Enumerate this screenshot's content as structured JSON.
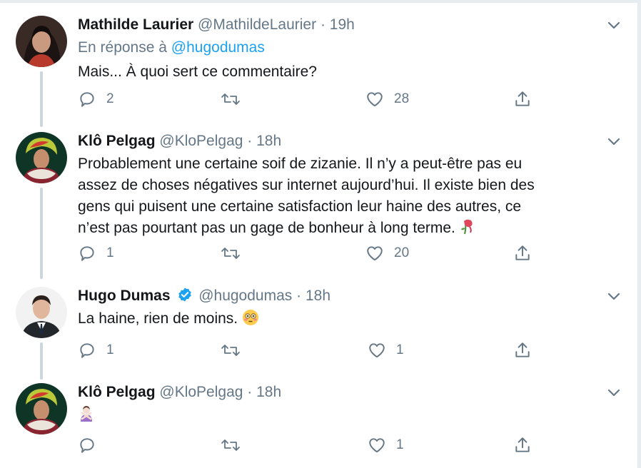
{
  "tweets": [
    {
      "name": "Mathilde Laurier",
      "handle": "@MathildeLaurier",
      "time": "19h",
      "reply_prefix": "En réponse à",
      "reply_handle": "@hugodumas",
      "text": "Mais... À quoi sert ce commentaire?",
      "replies": "2",
      "retweets": "",
      "likes": "28"
    },
    {
      "name": "Klô Pelgag",
      "handle": "@KloPelgag",
      "time": "18h",
      "text_lines": [
        "Probablement une certaine soif de zizanie. Il n’y a peut-être pas eu",
        "assez de choses négatives sur internet aujourd’hui. Il existe bien des",
        "gens qui puisent une certaine satisfaction leur haine des autres, ce",
        "n’est pas pourtant pas un gage de bonheur à long terme."
      ],
      "emoji": "wilted-rose",
      "replies": "1",
      "retweets": "",
      "likes": "20"
    },
    {
      "name": "Hugo Dumas",
      "verified": true,
      "handle": "@hugodumas",
      "time": "18h",
      "text": "La haine, rien de moins.",
      "emoji": "flushed-face",
      "replies": "1",
      "retweets": "",
      "likes": "1"
    },
    {
      "name": "Klô Pelgag",
      "handle": "@KloPelgag",
      "time": "18h",
      "emoji": "person-gesturing-no",
      "replies": "",
      "retweets": "",
      "likes": "1"
    }
  ],
  "separator": "·",
  "colors": {
    "text": "#14171a",
    "muted": "#657786",
    "link": "#1da1f2",
    "thread_line": "#ccd6dd"
  },
  "icons": [
    "reply-icon",
    "retweet-icon",
    "like-icon",
    "share-icon",
    "caret-down-icon",
    "verified-badge-icon"
  ]
}
